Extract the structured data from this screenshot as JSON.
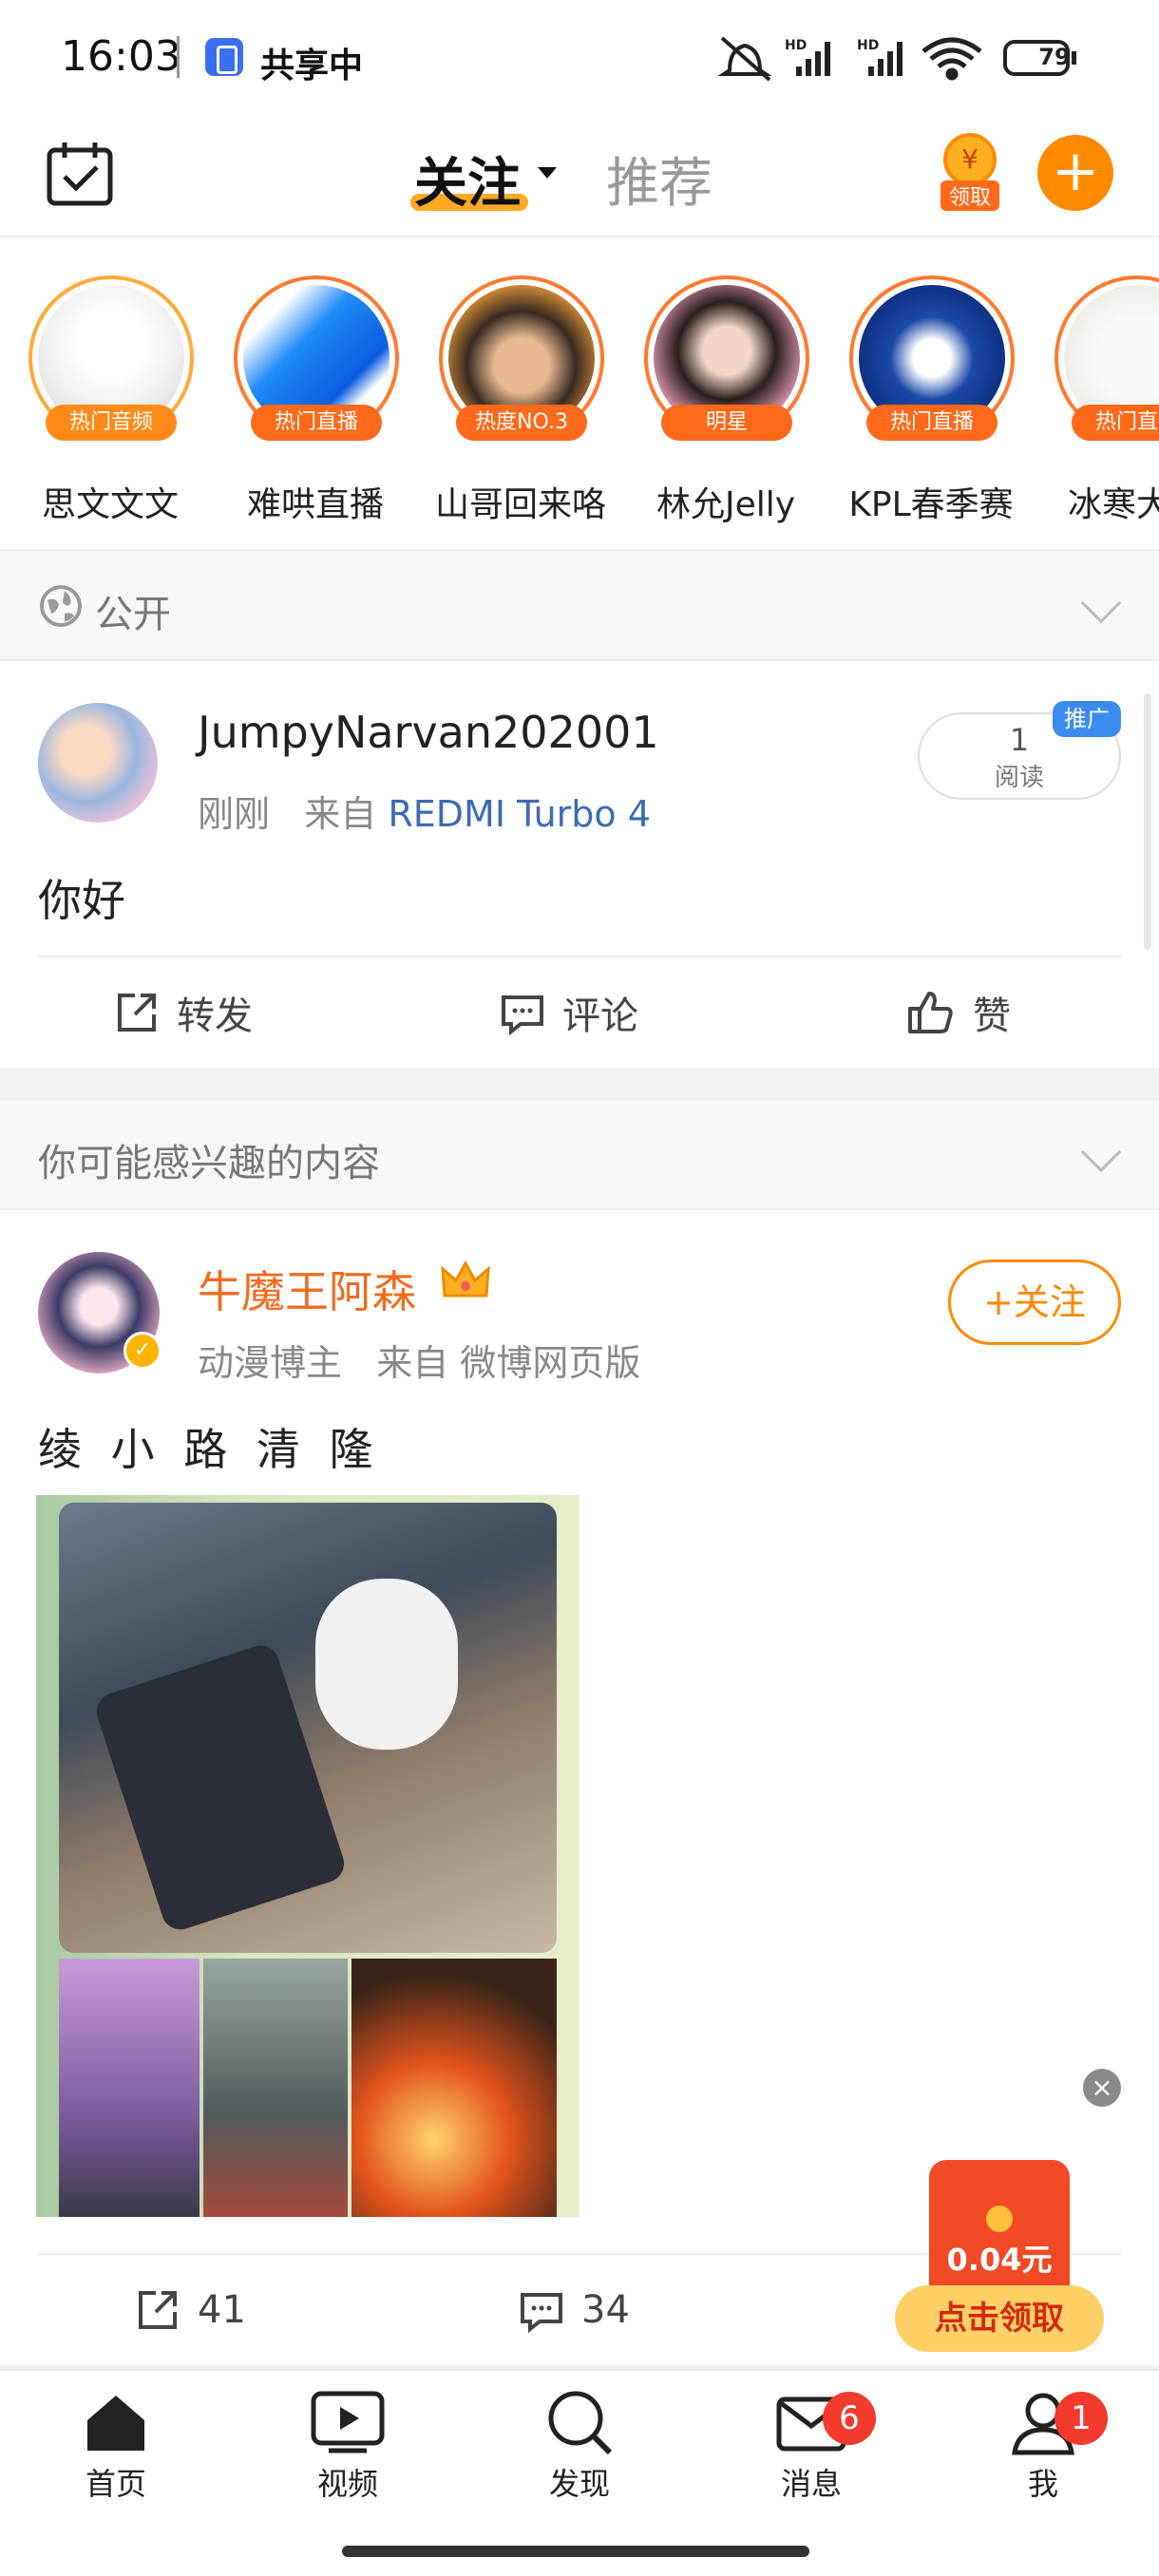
{
  "status_bar": {
    "time": "16:03",
    "share_label": "共享中",
    "battery": "79"
  },
  "header": {
    "tab_follow": "关注",
    "tab_recommend": "推荐",
    "coin_label": "领取",
    "add_label": "+"
  },
  "stories": [
    {
      "name": "思文文文",
      "badge": "热门音频"
    },
    {
      "name": "难哄直播",
      "badge": "热门直播"
    },
    {
      "name": "山哥回来咯",
      "badge": "热度NO.3"
    },
    {
      "name": "林允Jelly",
      "badge": "明星"
    },
    {
      "name": "KPL春季赛",
      "badge": "热门直播"
    },
    {
      "name": "冰寒大玩",
      "badge": "热门直播"
    }
  ],
  "visibility": {
    "label": "公开"
  },
  "post1": {
    "username": "JumpyNarvan202001",
    "time": "刚刚",
    "from_label": "来自",
    "device": "REDMI Turbo 4",
    "read_count": "1",
    "read_label": "阅读",
    "promo_label": "推广",
    "content": "你好",
    "actions": {
      "repost": "转发",
      "comment": "评论",
      "like": "赞"
    }
  },
  "interest_section": {
    "label": "你可能感兴趣的内容"
  },
  "post2": {
    "username": "牛魔王阿森",
    "role": "动漫博主",
    "from_label": "来自",
    "source": "微博网页版",
    "follow_label": "+关注",
    "content": "绫 小 路 清 隆",
    "reposts": "41",
    "comments": "34"
  },
  "red_packet": {
    "amount": "0.04元",
    "claim_label": "点击领取"
  },
  "bottom_nav": [
    {
      "label": "首页"
    },
    {
      "label": "视频"
    },
    {
      "label": "发现"
    },
    {
      "label": "消息",
      "badge": "6"
    },
    {
      "label": "我",
      "badge": "1"
    }
  ],
  "colors": {
    "accent": "#ff8a00",
    "badge_red": "#f23a2d",
    "link_blue": "#3d6bb3"
  }
}
